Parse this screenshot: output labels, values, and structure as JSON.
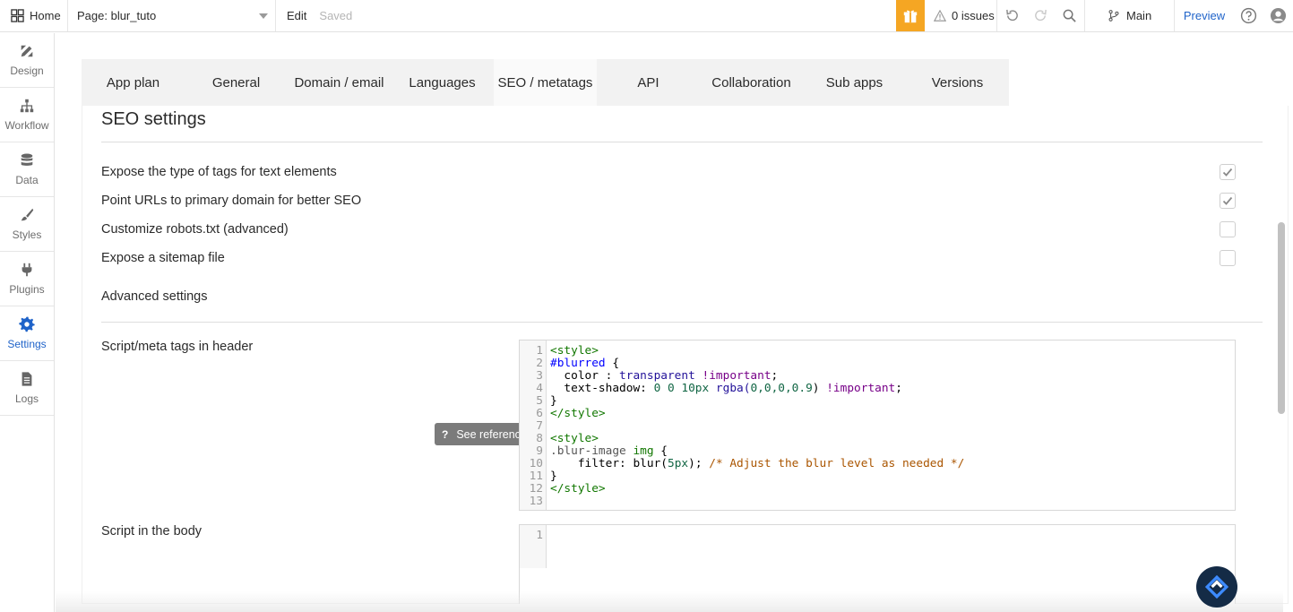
{
  "topbar": {
    "home_label": "Home",
    "page_label": "Page: blur_tuto",
    "edit_label": "Edit",
    "saved_label": "Saved",
    "issues_label": "0 issues",
    "branch_label": "Main",
    "preview_label": "Preview"
  },
  "sidebar": {
    "items": [
      {
        "label": "Design",
        "icon": "design-icon"
      },
      {
        "label": "Workflow",
        "icon": "workflow-icon"
      },
      {
        "label": "Data",
        "icon": "database-icon"
      },
      {
        "label": "Styles",
        "icon": "brush-icon"
      },
      {
        "label": "Plugins",
        "icon": "plug-icon"
      },
      {
        "label": "Settings",
        "icon": "gear-icon",
        "active": true
      },
      {
        "label": "Logs",
        "icon": "document-icon"
      }
    ]
  },
  "tabs": [
    "App plan",
    "General",
    "Domain / email",
    "Languages",
    "SEO / metatags",
    "API",
    "Collaboration",
    "Sub apps",
    "Versions"
  ],
  "active_tab": "SEO / metatags",
  "seo": {
    "title": "SEO settings",
    "options": [
      {
        "label": "Expose the type of tags for text elements",
        "checked": true
      },
      {
        "label": "Point URLs to primary domain for better SEO",
        "checked": true
      },
      {
        "label": "Customize robots.txt (advanced)",
        "checked": false
      },
      {
        "label": "Expose a sitemap file",
        "checked": false
      }
    ],
    "advanced_label": "Advanced settings",
    "header_label": "Script/meta tags in header",
    "body_label": "Script in the body",
    "reference_label": "See reference →",
    "reference_q": "?"
  },
  "header_code": {
    "line_numbers": [
      "1",
      "2",
      "3",
      "4",
      "5",
      "6",
      "7",
      "8",
      "9",
      "10",
      "11",
      "12",
      "13"
    ],
    "l1": "<style>",
    "l2_sel": "#blurred",
    "l2_rest": " {",
    "l3_prop": "  color : ",
    "l3_val": "transparent",
    "l3_kw": " !important",
    "l3_end": ";",
    "l4_prop": "  text-shadow: ",
    "l4_num": "0 0 10px",
    "l4_fn": " rgba(",
    "l4_args": "0,0,0,0.9",
    "l4_close": ")",
    "l4_kw": " !important",
    "l4_end": ";",
    "l5": "}",
    "l6": "</style>",
    "l8": "<style>",
    "l9_sel": ".blur-image ",
    "l9_tag": "img",
    "l9_rest": " {",
    "l10_prop": "    filter: ",
    "l10_fn": "blur(",
    "l10_num": "5px",
    "l10_close": "); ",
    "l10_com": "/* Adjust the blur level as needed */",
    "l11": "}",
    "l12": "</style>"
  },
  "body_code": {
    "line_numbers": [
      "1"
    ]
  },
  "colors": {
    "accent": "#1f63c9",
    "gift": "#f5a623",
    "chat_bubble": "#142b46"
  }
}
